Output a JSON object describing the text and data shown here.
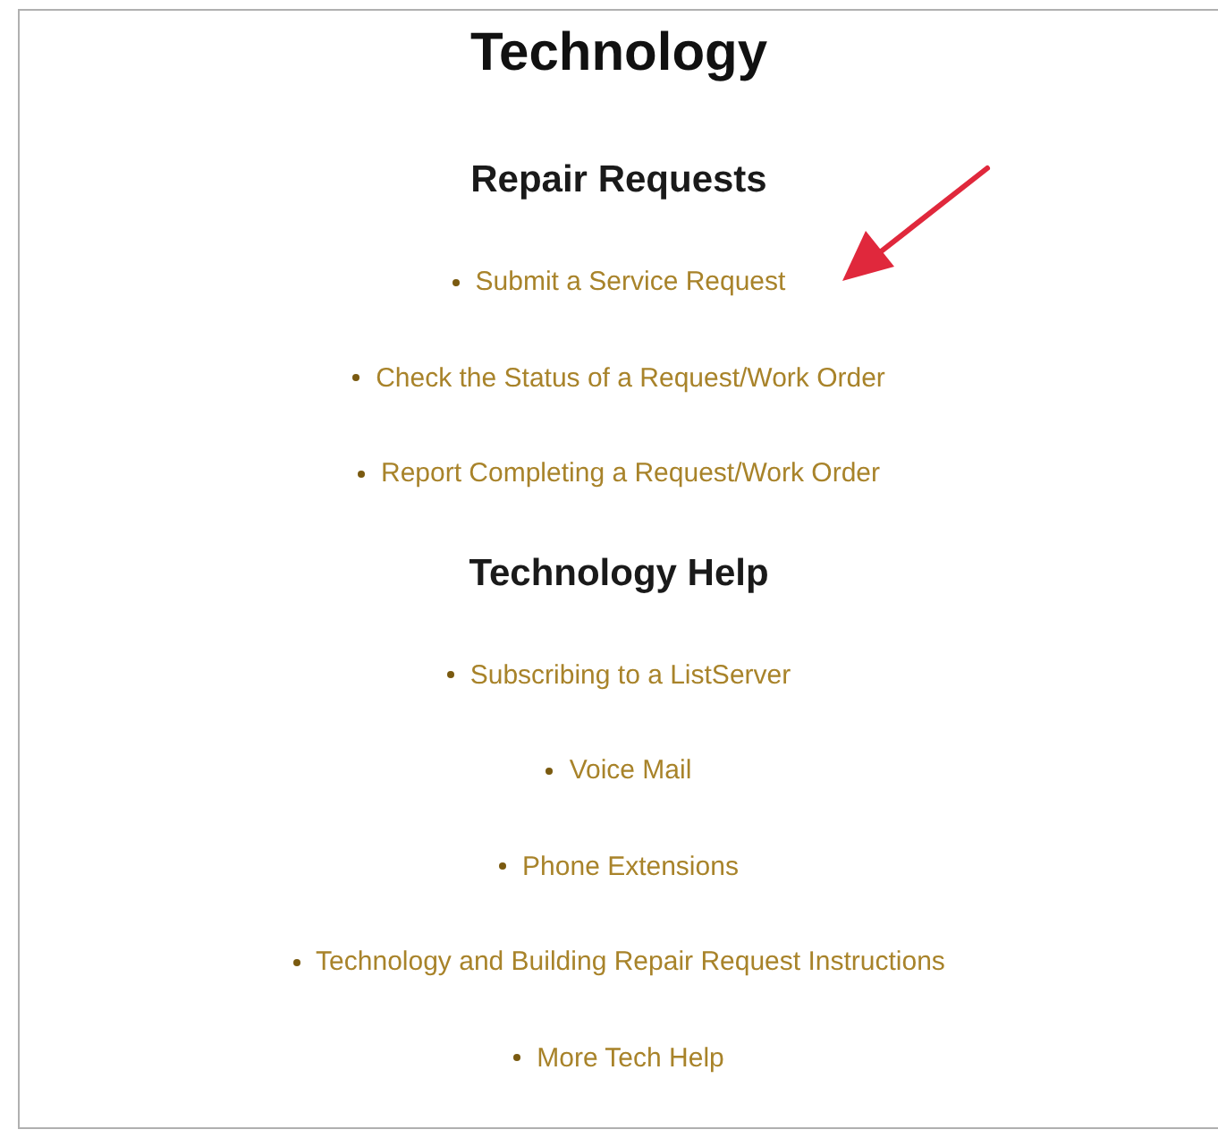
{
  "title": "Technology",
  "sections": [
    {
      "heading": "Repair Requests",
      "links": [
        "Submit a Service Request",
        "Check the Status of a Request/Work Order",
        "Report Completing a Request/Work Order"
      ]
    },
    {
      "heading": "Technology Help",
      "links": [
        "Subscribing to a ListServer",
        "Voice Mail",
        "Phone Extensions",
        "Technology and Building Repair Request Instructions",
        "More Tech Help"
      ]
    }
  ]
}
